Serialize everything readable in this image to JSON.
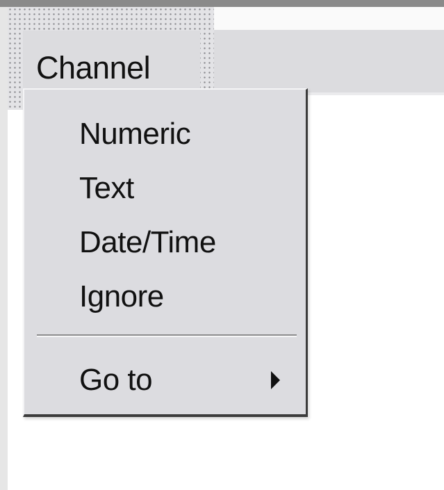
{
  "column_header": {
    "label": "Channel"
  },
  "context_menu": {
    "items": [
      {
        "label": "Numeric"
      },
      {
        "label": "Text"
      },
      {
        "label": "Date/Time"
      },
      {
        "label": "Ignore"
      }
    ],
    "goto": {
      "label": "Go to",
      "submenu_icon": "submenu-arrow-icon"
    }
  }
}
